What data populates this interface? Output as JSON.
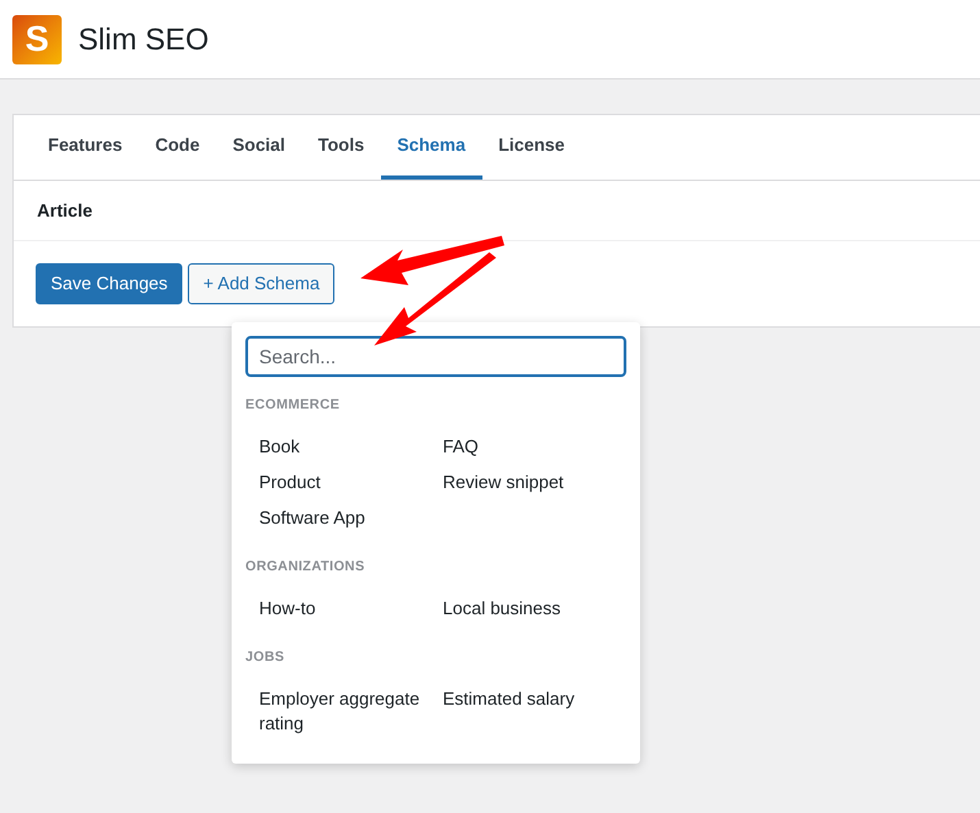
{
  "header": {
    "logo_letter": "S",
    "title": "Slim SEO"
  },
  "tabs": [
    {
      "label": "Features",
      "selected": false
    },
    {
      "label": "Code",
      "selected": false
    },
    {
      "label": "Social",
      "selected": false
    },
    {
      "label": "Tools",
      "selected": false
    },
    {
      "label": "Schema",
      "selected": true
    },
    {
      "label": "License",
      "selected": false
    }
  ],
  "section_title": "Article",
  "buttons": [
    {
      "kind": "primary",
      "label": "Save Changes"
    },
    {
      "kind": "secondary",
      "label": "+ Add Schema"
    }
  ],
  "dropdown": {
    "search": {
      "placeholder": "Search..."
    },
    "groups": [
      {
        "title": "ECOMMERCE",
        "items": [
          "Book",
          "FAQ",
          "Product",
          "Review snippet",
          "Software App"
        ]
      },
      {
        "title": "ORGANIZATIONS",
        "items": [
          "How-to",
          "Local business"
        ]
      },
      {
        "title": "JOBS",
        "items": [
          "Employer aggregate rating",
          "Estimated salary"
        ]
      }
    ]
  }
}
